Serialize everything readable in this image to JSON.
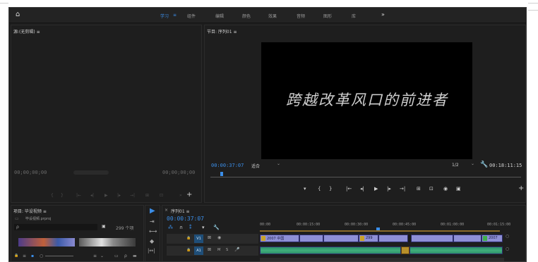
{
  "app": {
    "home_icon": "home-icon",
    "workspaces": [
      {
        "label": "学习",
        "active": true
      },
      {
        "label": "≡",
        "active": true
      },
      {
        "label": "组件",
        "active": false
      },
      {
        "label": "编辑",
        "active": false
      },
      {
        "label": "颜色",
        "active": false
      },
      {
        "label": "效果",
        "active": false
      },
      {
        "label": "音频",
        "active": false
      },
      {
        "label": "图形",
        "active": false
      },
      {
        "label": "库",
        "active": false
      }
    ],
    "more_label": "»"
  },
  "source": {
    "title": "源:(无剪辑) ≡",
    "tc_left": "00;00;00;00",
    "tc_right": "00;00;00;00",
    "controls": [
      "{",
      "}",
      "|←",
      "◂|",
      "▶",
      "|▸",
      "→|",
      "⊞",
      "⊡",
      "»",
      "+"
    ]
  },
  "program": {
    "title": "节目: 序列01 ≡",
    "overlay_text": "跨越改革风口的前进者",
    "tc_current": "00:00:37:07",
    "fit_label": "适合",
    "fit_arrow": "⌄",
    "ratio": "1/2",
    "ratio_arrow": "⌄",
    "wrench_icon": "wrench-icon",
    "tc_duration": "00:18:11:15",
    "controls": [
      "▾",
      "{",
      "}",
      "|←",
      "◂|",
      "▶",
      "|▸",
      "→|",
      "⊞",
      "⊡",
      "◉",
      "▣"
    ],
    "add_label": "+"
  },
  "project": {
    "title": "项目: 毕设视频 ≡",
    "filename": "毕设视频.prproj",
    "search_placeholder": "ρ",
    "item_count": "299 个项",
    "bottom_icons": [
      "🔒",
      "≡",
      "▪",
      "○",
      "≡",
      "⌄",
      "▭",
      "ρ",
      "▬"
    ]
  },
  "timeline": {
    "close": "×",
    "title": "序列01 ≡",
    "tc": "00:00:37:07",
    "ruler": [
      "00:00",
      "00:00:15:00",
      "00:00:30:00",
      "00:00:45:00",
      "00:01:00:00",
      "00:01:15:00"
    ],
    "tracks": [
      {
        "lock": "🔒",
        "name": "V1",
        "icons": [
          "⊠",
          "◉"
        ]
      },
      {
        "lock": "🔒",
        "name": "A1",
        "icons": [
          "⊠",
          "M",
          "S",
          "🎤"
        ]
      }
    ],
    "video_clip_labels": [
      "2007 中国",
      "299",
      "2007"
    ],
    "scroll_left": "○",
    "scroll_right": "○"
  },
  "tools": [
    "▶",
    "⇥",
    "⟷",
    "◆",
    "|↔|"
  ],
  "colors": {
    "accent": "#3b8ee8",
    "video_clip": "#8e8fd6",
    "audio_clip": "#2f8f6a",
    "panel_bg": "#1e1e1e"
  }
}
